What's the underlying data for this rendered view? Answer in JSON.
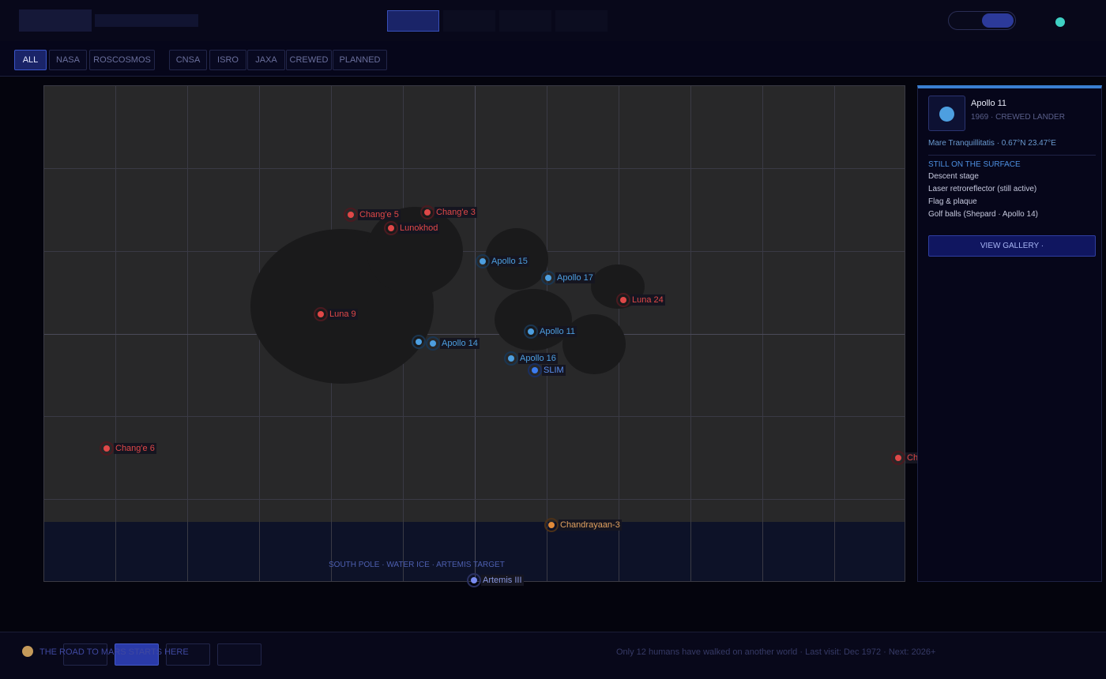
{
  "colors": {
    "nasa": "#4d9fe0",
    "soviet": "#e04848",
    "cnsa": "#e04848",
    "isro": "#e08a3a",
    "jaxa": "#3d7df0",
    "planned": "#7a8cf0",
    "accent": "#3a55c8",
    "status": "#3fd1c4"
  },
  "filters": [
    "ALL",
    "NASA",
    "ROSCOSMOS",
    "CNSA",
    "ISRO",
    "JAXA",
    "CREWED",
    "PLANNED"
  ],
  "active_filter": "ALL",
  "map": {
    "south_region_label": "SOUTH POLE · WATER ICE · ARTEMIS TARGET",
    "markers": [
      {
        "label": "Chang'e 5",
        "color": "#e04848",
        "icon": "lander-dot"
      },
      {
        "label": "Chang'e 3",
        "color": "#e04848",
        "icon": "lander-dot"
      },
      {
        "label": "Lunokhod",
        "color": "#e04848",
        "icon": "lander-dot"
      },
      {
        "label": "Apollo 15",
        "color": "#4d9fe0",
        "icon": "lander-dot"
      },
      {
        "label": "Apollo 17",
        "color": "#4d9fe0",
        "icon": "lander-dot"
      },
      {
        "label": "Luna 24",
        "color": "#e04848",
        "icon": "lander-dot"
      },
      {
        "label": "Luna 9",
        "color": "#e04848",
        "icon": "lander-dot"
      },
      {
        "label": "Apollo 11",
        "color": "#4d9fe0",
        "icon": "lander-dot"
      },
      {
        "label": "",
        "color": "#4d9fe0",
        "icon": "lander-dot"
      },
      {
        "label": "Apollo 14",
        "color": "#4d9fe0",
        "icon": "lander-dot"
      },
      {
        "label": "Apollo 16",
        "color": "#4d9fe0",
        "icon": "lander-dot"
      },
      {
        "label": "SLIM",
        "color": "#3d7df0",
        "icon": "lander-dot"
      },
      {
        "label": "Chang'e 6",
        "color": "#e04848",
        "icon": "lander-dot"
      },
      {
        "label": "Ch",
        "color": "#e04848",
        "icon": "lander-dot"
      },
      {
        "label": "Chandrayaan-3",
        "color": "#e08a3a",
        "icon": "lander-dot"
      },
      {
        "label": "Artemis III",
        "color": "#7a8cf0",
        "icon": "lander-dot"
      }
    ]
  },
  "detail": {
    "title": "Apollo 11",
    "subtitle": "1969 · CREWED LANDER",
    "location": "Mare Tranquillitatis · 0.67°N 23.47°E",
    "section_heading": "STILL ON THE SURFACE",
    "items": [
      "Descent stage",
      "Laser retroreflector (still active)",
      "Flag & plaque",
      "Golf balls (Shepard · Apollo 14)"
    ],
    "gallery_label": "VIEW GALLERY ·"
  },
  "footer": {
    "tagline": "THE ROAD TO MARS STARTS HERE",
    "note": "Only 12 humans have walked on another world · Last visit: Dec 1972 · Next: 2026+"
  }
}
